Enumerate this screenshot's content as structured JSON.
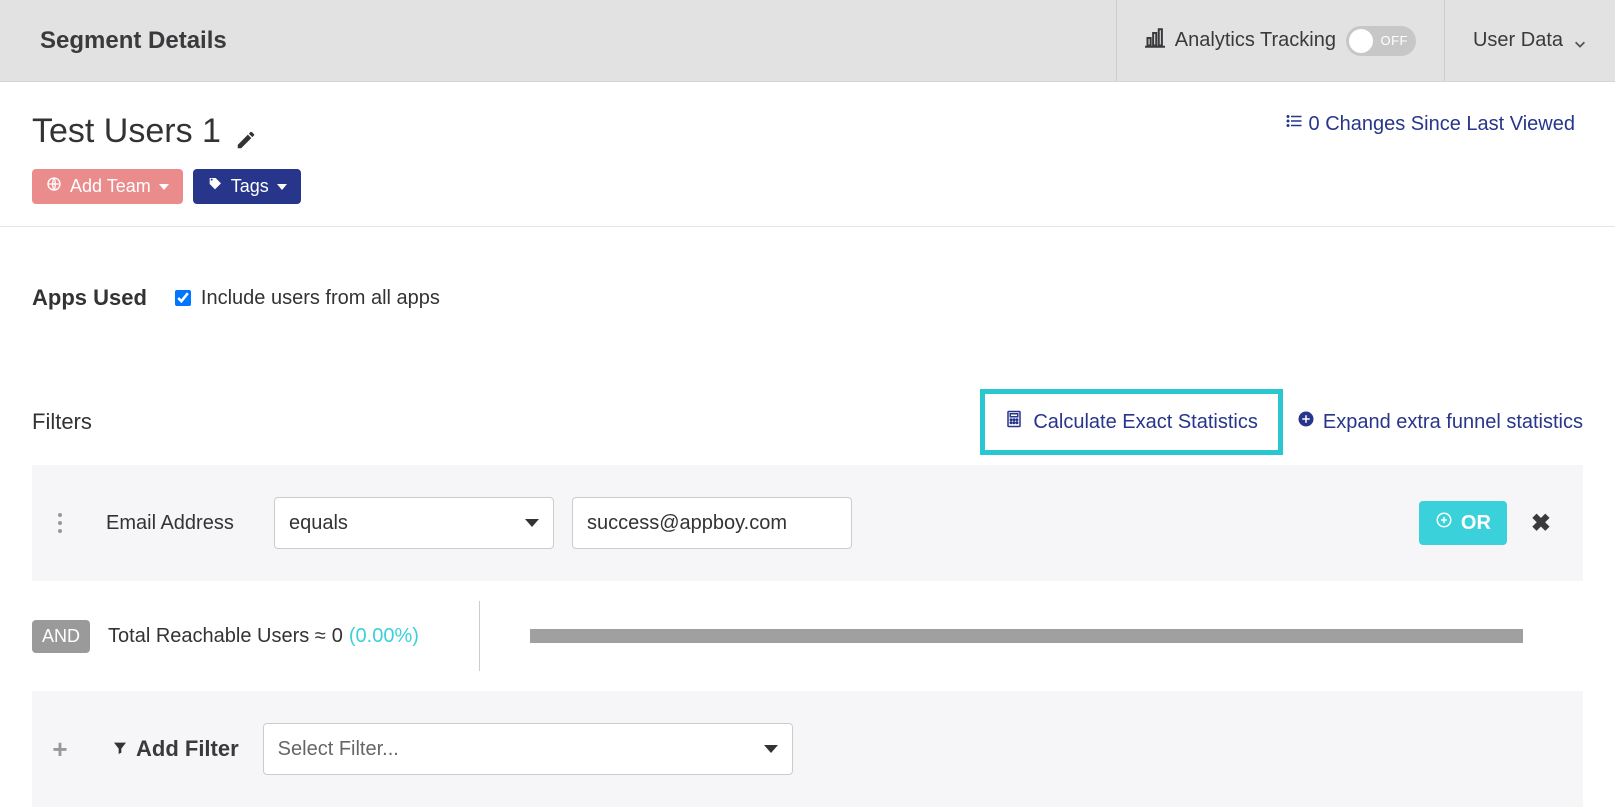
{
  "header": {
    "title": "Segment Details",
    "analytics_label": "Analytics Tracking",
    "toggle_state": "OFF",
    "user_data": "User Data"
  },
  "segment": {
    "name": "Test Users 1",
    "add_team": "Add Team",
    "tags": "Tags",
    "changes_text": "0 Changes Since Last Viewed"
  },
  "apps": {
    "label": "Apps Used",
    "checkbox_label": "Include users from all apps",
    "checked": true
  },
  "filters": {
    "label": "Filters",
    "calc_label": "Calculate Exact Statistics",
    "expand_label": "Expand extra funnel statistics",
    "row": {
      "field": "Email Address",
      "operator": "equals",
      "value": "success@appboy.com",
      "or_label": "OR"
    },
    "and_label": "AND",
    "stats": {
      "prefix": "Total Reachable Users ≈",
      "value": "0",
      "pct": "(0.00%)"
    },
    "add": {
      "label": "Add Filter",
      "placeholder": "Select Filter..."
    }
  }
}
